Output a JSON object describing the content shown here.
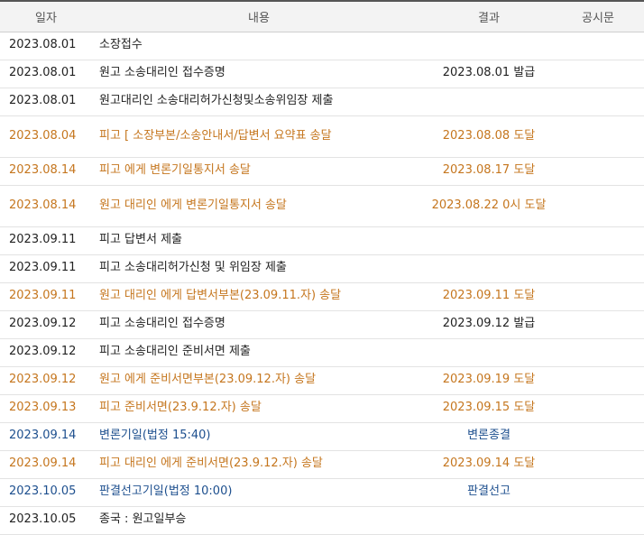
{
  "headers": {
    "date": "일자",
    "content": "내용",
    "result": "결과",
    "notice": "공시문"
  },
  "rows": [
    {
      "date": "2023.08.01",
      "content": "소장접수",
      "result": "",
      "notice": ""
    },
    {
      "date": "2023.08.01",
      "content": "원고 소송대리인      접수증명",
      "result": "2023.08.01 발급",
      "notice": ""
    },
    {
      "date": "2023.08.01",
      "content": "원고대리인      소송대리허가신청및소송위임장 제출",
      "result": "",
      "notice": ""
    },
    {
      "date": "2023.08.04",
      "content": "피고 [                    소장부본/소송안내서/답변서 요약표 송달",
      "result": "2023.08.08 도달",
      "notice": ""
    },
    {
      "date": "2023.08.14",
      "content": "피고                          에게 변론기일통지서 송달",
      "result": "2023.08.17 도달",
      "notice": ""
    },
    {
      "date": "2023.08.14",
      "content": "원고 대리인      에게 변론기일통지서 송달",
      "result": "2023.08.22 0시 도달",
      "notice": ""
    },
    {
      "date": "2023.09.11",
      "content": "피고                  답변서 제출",
      "result": "",
      "notice": ""
    },
    {
      "date": "2023.09.11",
      "content": "피고                          소송대리허가신청 및 위임장 제출",
      "result": "",
      "notice": ""
    },
    {
      "date": "2023.09.11",
      "content": "원고 대리인      에게 답변서부본(23.09.11.자) 송달",
      "result": "2023.09.11 도달",
      "notice": ""
    },
    {
      "date": "2023.09.12",
      "content": "피고 소송대리인        접수증명",
      "result": "2023.09.12 발급",
      "notice": ""
    },
    {
      "date": "2023.09.12",
      "content": "피고 소송대리인        준비서면 제출",
      "result": "",
      "notice": ""
    },
    {
      "date": "2023.09.12",
      "content": "원고        에게 준비서면부본(23.09.12.자) 송달",
      "result": "2023.09.19 도달",
      "notice": ""
    },
    {
      "date": "2023.09.13",
      "content": "피고                          준비서면(23.9.12.자) 송달",
      "result": "2023.09.15 도달",
      "notice": ""
    },
    {
      "date": "2023.09.14",
      "content": "변론기일(법정 15:40)",
      "result": "변론종결",
      "notice": ""
    },
    {
      "date": "2023.09.14",
      "content": "피고 대리인        에게 준비서면(23.9.12.자) 송달",
      "result": "2023.09.14 도달",
      "notice": ""
    },
    {
      "date": "2023.10.05",
      "content": "판결선고기일(법정 10:00)",
      "result": "판결선고",
      "notice": ""
    },
    {
      "date": "2023.10.05",
      "content": "종국 : 원고일부승",
      "result": "",
      "notice": ""
    }
  ],
  "colors": {
    "black": "#222222",
    "orange": "#c5761e",
    "blue": "#1d4f8e"
  }
}
